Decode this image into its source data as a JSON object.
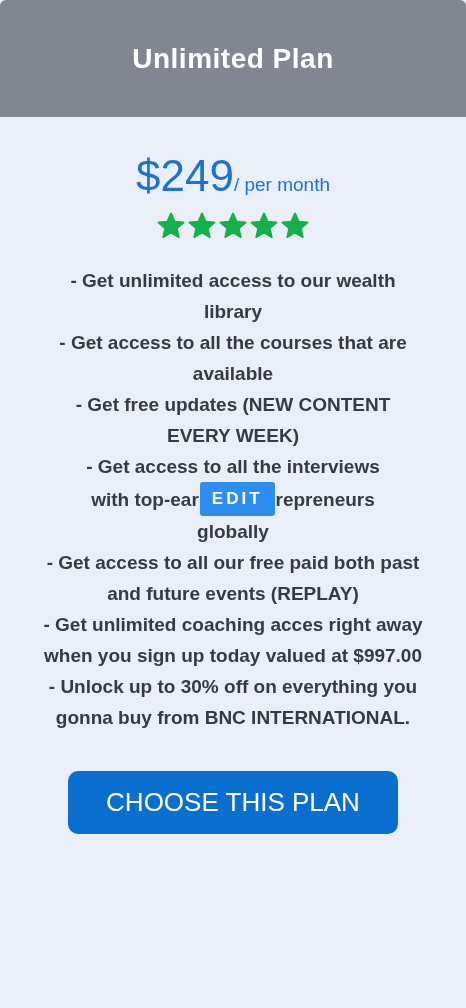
{
  "plan": {
    "title": "Unlimited Plan",
    "price": "$249",
    "period": "/ per month",
    "stars": 5
  },
  "features": [
    {
      "text": "- Get unlimited access to our wealth library"
    },
    {
      "text": "- Get access to all the courses that are available"
    },
    {
      "text": "- Get free updates (NEW CONTENT EVERY WEEK)"
    },
    {
      "text": "- Get access to all the interviews",
      "text_before_button": "with top-ear",
      "overlay_button": "EDIT",
      "text_after_button": "repreneurs",
      "text_end": "globally"
    },
    {
      "text": "- Get access to all our free paid both past and future events (REPLAY)"
    },
    {
      "text": "- Get unlimited coaching acces right away when you sign up today valued at $997.00"
    },
    {
      "text": "- Unlock up to 30% off on everything you gonna buy from BNC INTERNATIONAL."
    }
  ],
  "cta": "CHOOSE THIS PLAN"
}
